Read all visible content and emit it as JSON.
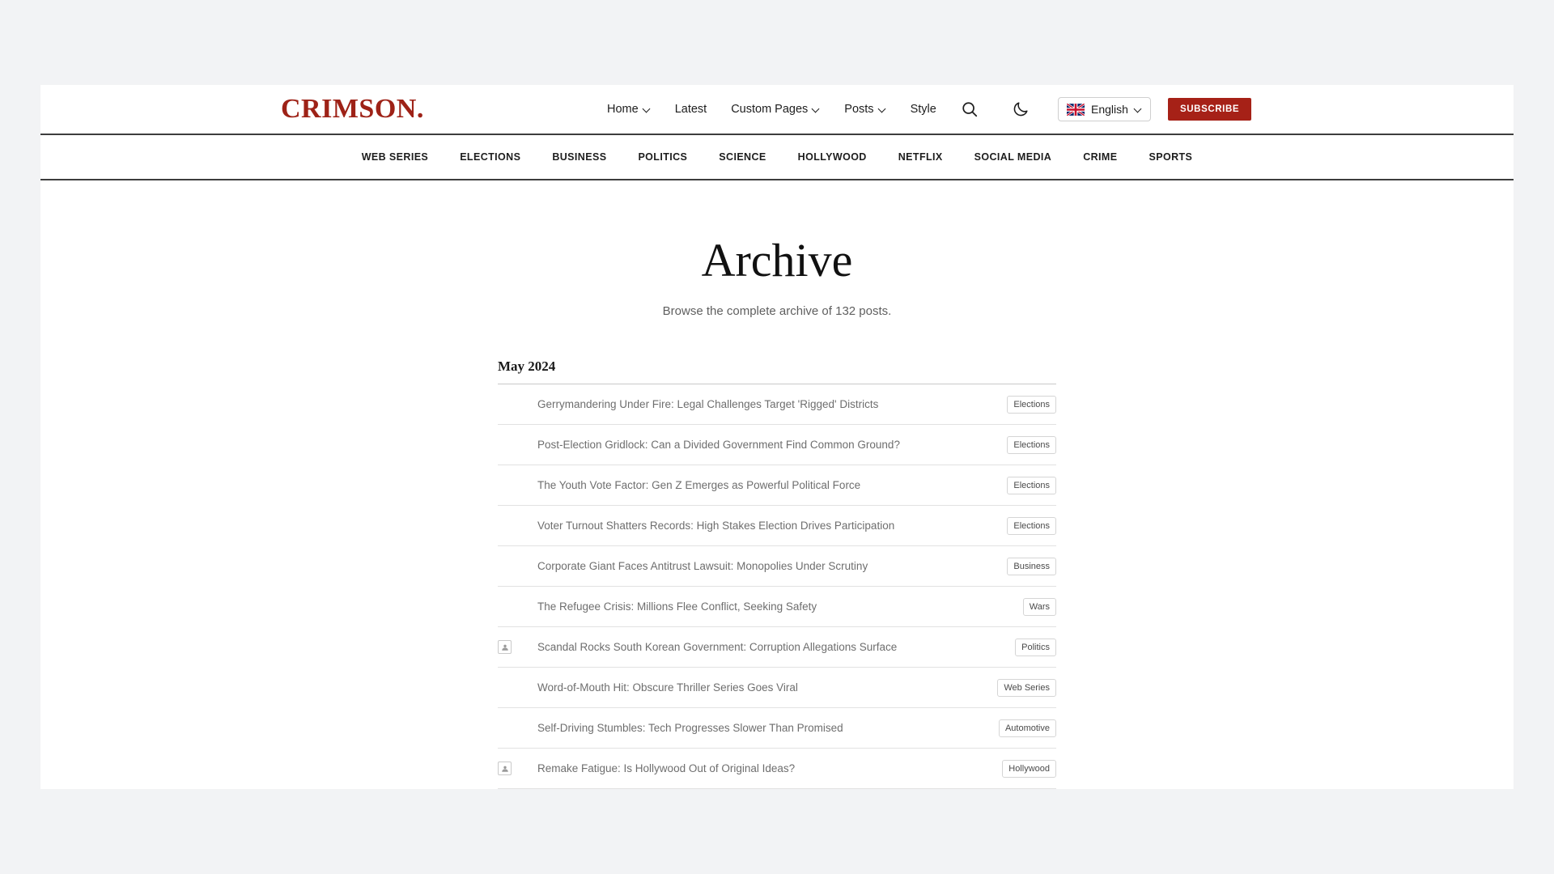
{
  "theme": {
    "brand_color": "#9e2217",
    "accent_color": "#a62117",
    "page_background": "#f2f3f5"
  },
  "header": {
    "logo": "CRIMSON.",
    "nav": [
      {
        "label": "Home",
        "has_dropdown": true
      },
      {
        "label": "Latest",
        "has_dropdown": false
      },
      {
        "label": "Custom Pages",
        "has_dropdown": true
      },
      {
        "label": "Posts",
        "has_dropdown": true
      },
      {
        "label": "Style",
        "has_dropdown": false
      }
    ],
    "search_icon": "search-icon",
    "theme_icon": "moon-icon",
    "language": {
      "label": "English",
      "flag": "uk-flag-icon"
    },
    "subscribe_label": "SUBSCRIBE"
  },
  "categories": [
    "WEB SERIES",
    "ELECTIONS",
    "BUSINESS",
    "POLITICS",
    "SCIENCE",
    "HOLLYWOOD",
    "NETFLIX",
    "SOCIAL MEDIA",
    "CRIME",
    "SPORTS"
  ],
  "hero": {
    "title": "Archive",
    "subtitle": "Browse the complete archive of 132 posts."
  },
  "archive": {
    "month": "May 2024",
    "posts": [
      {
        "title": "Gerrymandering Under Fire: Legal Challenges Target 'Rigged' Districts",
        "tag": "Elections",
        "thumb": false
      },
      {
        "title": "Post-Election Gridlock: Can a Divided Government Find Common Ground?",
        "tag": "Elections",
        "thumb": false
      },
      {
        "title": "The Youth Vote Factor: Gen Z Emerges as Powerful Political Force",
        "tag": "Elections",
        "thumb": false
      },
      {
        "title": "Voter Turnout Shatters Records: High Stakes Election Drives Participation",
        "tag": "Elections",
        "thumb": false
      },
      {
        "title": "Corporate Giant Faces Antitrust Lawsuit: Monopolies Under Scrutiny",
        "tag": "Business",
        "thumb": false
      },
      {
        "title": "The Refugee Crisis: Millions Flee Conflict, Seeking Safety",
        "tag": "Wars",
        "thumb": false
      },
      {
        "title": "Scandal Rocks South Korean Government: Corruption Allegations Surface",
        "tag": "Politics",
        "thumb": true
      },
      {
        "title": "Word-of-Mouth Hit: Obscure Thriller Series Goes Viral",
        "tag": "Web Series",
        "thumb": false
      },
      {
        "title": "Self-Driving Stumbles: Tech Progresses Slower Than Promised",
        "tag": "Automotive",
        "thumb": false
      },
      {
        "title": "Remake Fatigue: Is Hollywood Out of Original Ideas?",
        "tag": "Hollywood",
        "thumb": true
      }
    ]
  }
}
